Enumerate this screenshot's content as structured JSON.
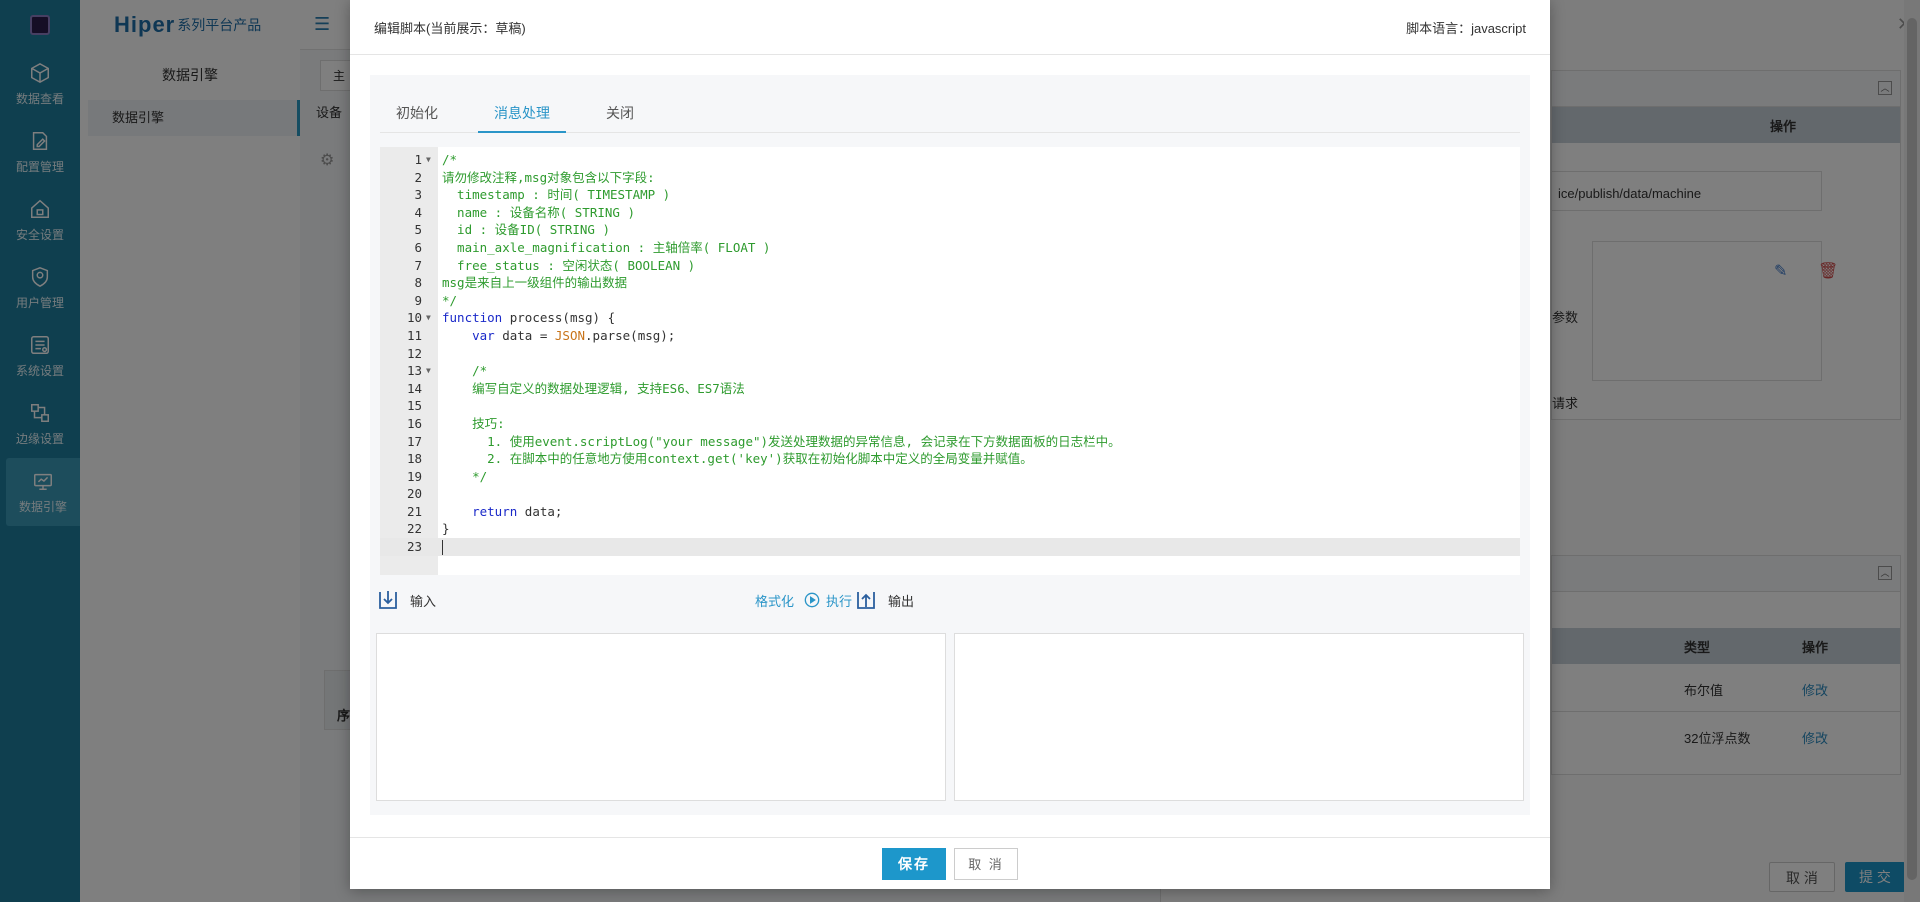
{
  "rail": {
    "items": [
      {
        "label": "数据查看",
        "icon": "cube-icon"
      },
      {
        "label": "配置管理",
        "icon": "file-edit-icon"
      },
      {
        "label": "安全设置",
        "icon": "house-lock-icon"
      },
      {
        "label": "用户管理",
        "icon": "user-shield-icon"
      },
      {
        "label": "系统设置",
        "icon": "settings-board-icon"
      },
      {
        "label": "边缘设置",
        "icon": "network-nodes-icon"
      },
      {
        "label": "数据引擎",
        "icon": "engine-icon"
      }
    ]
  },
  "sidebar": {
    "brand_main": "Hiper",
    "brand_sub": "系列平台产品",
    "title": "数据引擎",
    "items": [
      {
        "label": "数据引擎"
      }
    ]
  },
  "background": {
    "tab": "主",
    "label": "设备",
    "panel_header_op": "操作",
    "topic_text": "ice/publish/data/machine",
    "param_text": "参数",
    "request_text": "请求",
    "table2": {
      "headers": [
        "类型",
        "操作"
      ],
      "rows": [
        {
          "type": "布尔值",
          "action": "修改"
        },
        {
          "type": "32位浮点数",
          "action": "修改"
        }
      ]
    },
    "left_th": "序",
    "buttons": {
      "cancel": "取 消",
      "submit": "提 交"
    }
  },
  "modal": {
    "title": "编辑脚本(当前展示：草稿)",
    "language_label": "脚本语言：javascript",
    "tabs": [
      {
        "label": "初始化",
        "active": false
      },
      {
        "label": "消息处理",
        "active": true
      },
      {
        "label": "关闭",
        "active": false
      }
    ],
    "code_lines": [
      "/*",
      "请勿修改注释,msg对象包含以下字段:",
      "  timestamp : 时间( TIMESTAMP )",
      "  name : 设备名称( STRING )",
      "  id : 设备ID( STRING )",
      "  main_axle_magnification : 主轴倍率( FLOAT )",
      "  free_status : 空闲状态( BOOLEAN )",
      "msg是来自上一级组件的输出数据",
      "*/",
      "function process(msg) {",
      "    var data = JSON.parse(msg);",
      "",
      "    /*",
      "    编写自定义的数据处理逻辑, 支持ES6、ES7语法",
      "",
      "    技巧:",
      "      1. 使用event.scriptLog(\"your message\")发送处理数据的异常信息, 会记录在下方数据面板的日志栏中。",
      "      2. 在脚本中的任意地方使用context.get('key')获取在初始化脚本中定义的全局变量并赋值。",
      "    */",
      "",
      "    return data;",
      "}",
      ""
    ],
    "input_label": "输入",
    "output_label": "输出",
    "format_label": "格式化",
    "run_label": "执行",
    "save_label": "保存",
    "cancel_label": "取 消"
  },
  "colors": {
    "rail": "#1f7f9f",
    "accent": "#2a95c8",
    "primary_button": "#1d97cb",
    "comment": "#2e9b2e",
    "keyword": "#1a29c9",
    "object": "#c8741a"
  }
}
